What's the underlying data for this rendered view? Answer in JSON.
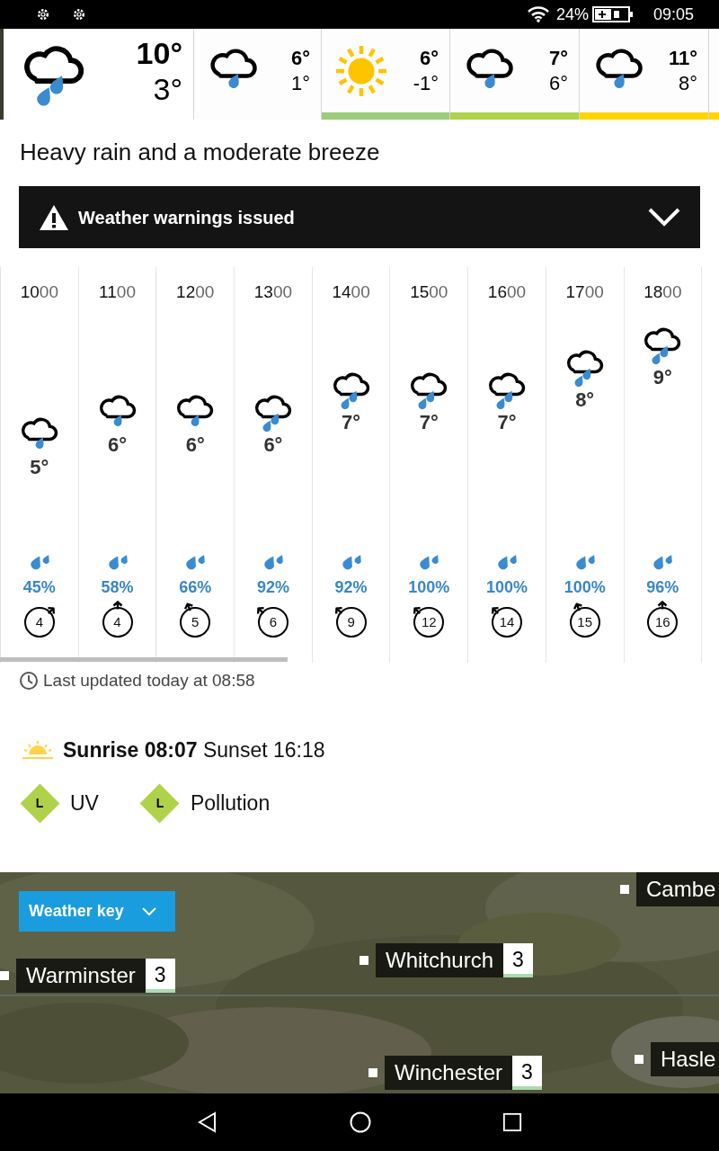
{
  "status_bar": {
    "battery": "24%",
    "time": "09:05"
  },
  "days": [
    {
      "kind": "heavy_rain",
      "high": "10°",
      "low": "3°",
      "selected": true
    },
    {
      "kind": "light_rain",
      "high": "6°",
      "low": "1°",
      "selected": false
    },
    {
      "kind": "sunny",
      "high": "6°",
      "low": "-1°",
      "selected": false,
      "color": "#9ccd7c"
    },
    {
      "kind": "light_rain",
      "high": "7°",
      "low": "6°",
      "selected": false,
      "color": "#b0d24a"
    },
    {
      "kind": "light_rain",
      "high": "11°",
      "low": "8°",
      "selected": false,
      "color": "#ffd500"
    },
    {
      "selected": false,
      "color": "#ffd500"
    }
  ],
  "summary": "Heavy rain and a moderate breeze",
  "warning": {
    "label": "Weather warnings issued",
    "expanded": false
  },
  "hours": [
    {
      "hour": "10",
      "minutes": "00",
      "kind": "light_rain",
      "temp": "5°",
      "rain": "45%",
      "wind": {
        "speed": "4",
        "kind": "ne"
      }
    },
    {
      "hour": "11",
      "minutes": "00",
      "kind": "light_rain",
      "temp": "6°",
      "rain": "58%",
      "wind": {
        "speed": "4",
        "kind": "n"
      }
    },
    {
      "hour": "12",
      "minutes": "00",
      "kind": "light_rain",
      "temp": "6°",
      "rain": "66%",
      "wind": {
        "speed": "5",
        "kind": "nnw"
      }
    },
    {
      "hour": "13",
      "minutes": "00",
      "kind": "heavy_rain",
      "temp": "6°",
      "rain": "92%",
      "wind": {
        "speed": "6",
        "kind": "nw"
      }
    },
    {
      "hour": "14",
      "minutes": "00",
      "kind": "heavy_rain",
      "temp": "7°",
      "rain": "92%",
      "wind": {
        "speed": "9",
        "kind": "nw"
      }
    },
    {
      "hour": "15",
      "minutes": "00",
      "kind": "heavy_rain",
      "temp": "7°",
      "rain": "100%",
      "wind": {
        "speed": "12",
        "kind": "nw"
      }
    },
    {
      "hour": "16",
      "minutes": "00",
      "kind": "heavy_rain",
      "temp": "7°",
      "rain": "100%",
      "wind": {
        "speed": "14",
        "kind": "nw"
      }
    },
    {
      "hour": "17",
      "minutes": "00",
      "kind": "heavy_rain",
      "temp": "8°",
      "rain": "100%",
      "wind": {
        "speed": "15",
        "kind": "nnw"
      }
    },
    {
      "hour": "18",
      "minutes": "00",
      "kind": "heavy_rain",
      "temp": "9°",
      "rain": "96%",
      "wind": {
        "speed": "16",
        "kind": "n"
      }
    }
  ],
  "last_updated": "Last updated today at 08:58",
  "sun": "**Sunrise 08:07** Sunset 16:18",
  "indices": [
    {
      "badge": "L",
      "label": "UV",
      "color": "#b0d24a"
    },
    {
      "badge": "L",
      "label": "Pollution",
      "color": "#b0d24a"
    }
  ],
  "map": {
    "kind": "picture",
    "weather_key": "Weather key",
    "places": [
      {
        "name": "Cambe"
      },
      {
        "name": "Whitchurch",
        "value": "3"
      },
      {
        "name": "Warminster",
        "value": "3"
      },
      {
        "name": "Winchester",
        "value": "3"
      },
      {
        "name": "Hasle"
      }
    ]
  }
}
